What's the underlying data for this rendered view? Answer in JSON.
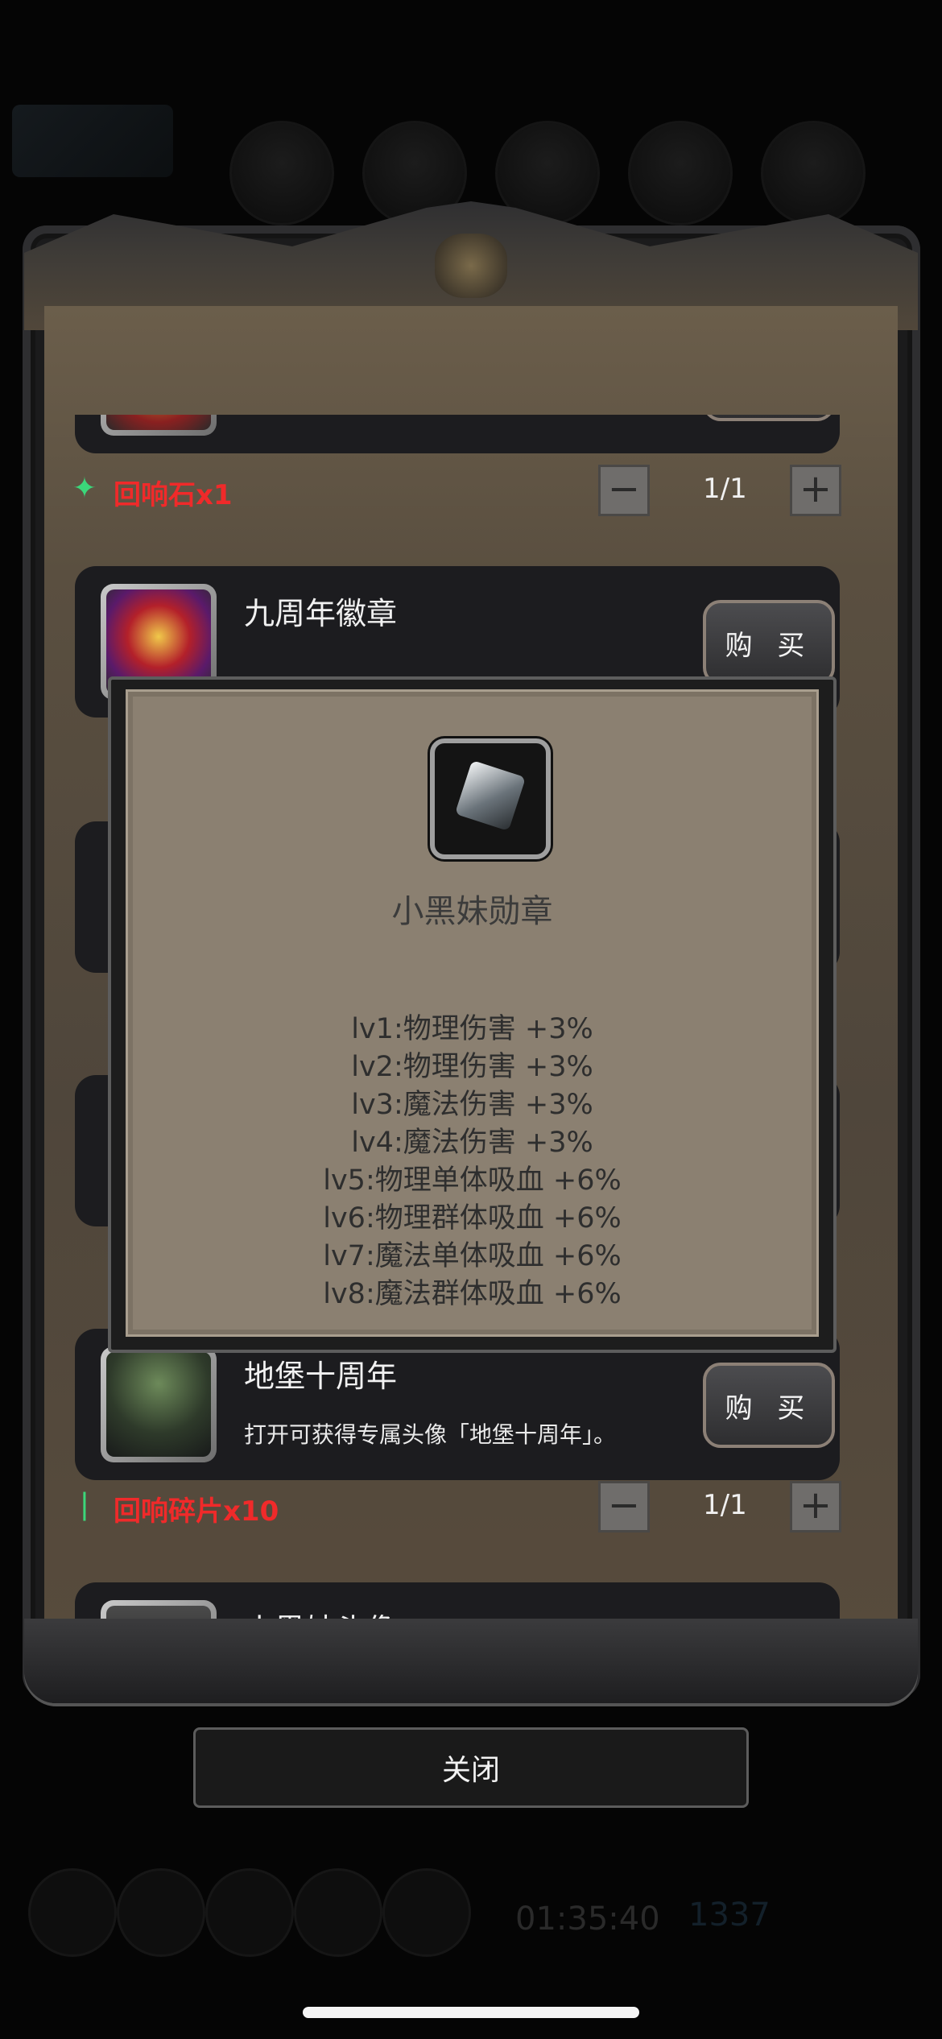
{
  "shop": {
    "items": [
      {
        "title": "",
        "description": "",
        "buy_label": "",
        "cost": {
          "icon": "green-crystal-icon",
          "label": "回响石x1",
          "quantity": "1/1"
        }
      },
      {
        "title": "九周年徽章",
        "description": "",
        "buy_label": "购 买"
      },
      {
        "title": "地堡十周年",
        "description": "打开可获得专属头像「地堡十周年」。",
        "buy_label": "购 买",
        "cost": {
          "icon": "green-shard-icon",
          "label": "回响碎片x10",
          "quantity": "1/1"
        }
      },
      {
        "title": "小黑妹头像"
      }
    ],
    "minus_label": "−",
    "plus_label": "+"
  },
  "detail": {
    "name": "小黑妹勋章",
    "icon": "silver-gem-icon",
    "stats": [
      "lv1:物理伤害 +3%",
      "lv2:物理伤害 +3%",
      "lv3:魔法伤害 +3%",
      "lv4:魔法伤害 +3%",
      "lv5:物理单体吸血 +6%",
      "lv6:物理群体吸血 +6%",
      "lv7:魔法单体吸血 +6%",
      "lv8:魔法群体吸血 +6%"
    ]
  },
  "footer": {
    "close_label": "关闭"
  },
  "background": {
    "timer": "01:35:40",
    "count": "1337"
  }
}
